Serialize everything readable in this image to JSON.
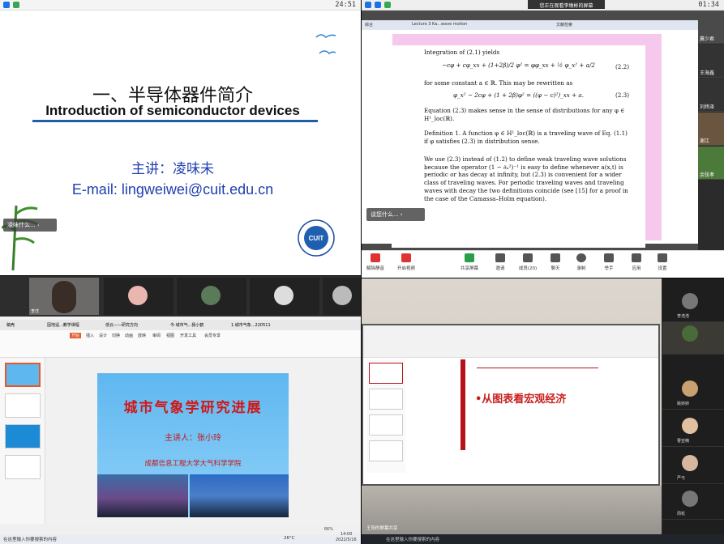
{
  "q1": {
    "time": "24:51",
    "slide": {
      "title_cn": "一、半导体器件简介",
      "title_en": "Introduction of semiconductor devices",
      "lecturer": "主讲：凌味未",
      "email": "E-mail: lingweiwei@cuit.edu.cn"
    },
    "caption": "凌味什么...",
    "logo_text": "CUIT"
  },
  "q2": {
    "banner": "您正在观看李墩彬的屏幕",
    "time": "01:34",
    "browser_tabs": [
      "综合",
      "Lecture 3 Ka...wave motion",
      "文献检索"
    ],
    "page": {
      "l1": "Integration of (2.1) yields",
      "eq1": "−cφ + cφ_xx + (1+2β)/2 φ² = φφ_xx + ½ φ_x² + a/2",
      "eq1n": "(2.2)",
      "l2": "for some constant a ∈ ℝ. This may be rewritten as",
      "eq2": "φ_x² − 2cφ + (1 + 2β)φ² = ((φ − c)²)_xx + a.",
      "eq2n": "(2.3)",
      "l3": "Equation (2.3) makes sense in the sense of distributions for any φ ∈ H¹_loc(ℝ).",
      "def": "Definition 1. A function φ ∈ H¹_loc(ℝ) is a traveling wave of Eq. (1.1) if φ satisfies (2.3) in distribution sense.",
      "l4": "We use (2.3) instead of (1.2) to define weak traveling wave solutions because the operator (1 − ∂ₓ²)⁻¹ is easy to define whenever a(x,t) is periodic or has decay at infinity, but (2.3) is convenient for a wider class of traveling waves. For periodic traveling waves and traveling waves with decay the two definitions coincide (see [15] for a proof in the case of the Camassa–Holm equation)."
    },
    "caption": "谈您什么...",
    "side_names": [
      "冀少君",
      "王海鑫",
      "刘炜泽",
      "谢江",
      "余弦孝"
    ],
    "tools": [
      "解除静音",
      "开启视频",
      "共享屏幕",
      "邀请",
      "成员(20)",
      "聊天",
      "录制",
      "举手",
      "应用",
      "设置"
    ]
  },
  "q3": {
    "video_names": [
      "李洋",
      "",
      "",
      "",
      ""
    ],
    "wps_tabs": [
      "稿壳",
      "因地遥...教学课程",
      "低云——研究方向",
      "今·城市气...我小鹤",
      "1.城市气象...220511"
    ],
    "ribbon": [
      "开始",
      "插入",
      "设计",
      "切换",
      "动画",
      "放映",
      "审阅",
      "视图",
      "开发工具",
      "会员专享"
    ],
    "slide": {
      "title": "城市气象学研究进展",
      "lecturer": "主讲人：张小玲",
      "institute": "成都信息工程大学大气科学学院"
    },
    "zoom": "66%",
    "taskbar_search": "在这里输入你要搜索的内容",
    "weather": "26°C",
    "clock": "14:00",
    "date": "2022/5/16"
  },
  "q4": {
    "slide_text": "•从图表看宏观经济",
    "taskbar_search": "在这里输入你要搜索的内容",
    "share_label": "王阳的屏幕共享",
    "side_names": [
      "李浩浩",
      "",
      "姚娇娇",
      "",
      "曹亚楠",
      "",
      "严弓",
      "",
      "周杭"
    ]
  },
  "colors": {
    "accent": "#1f3fb0",
    "red": "#d31616"
  }
}
